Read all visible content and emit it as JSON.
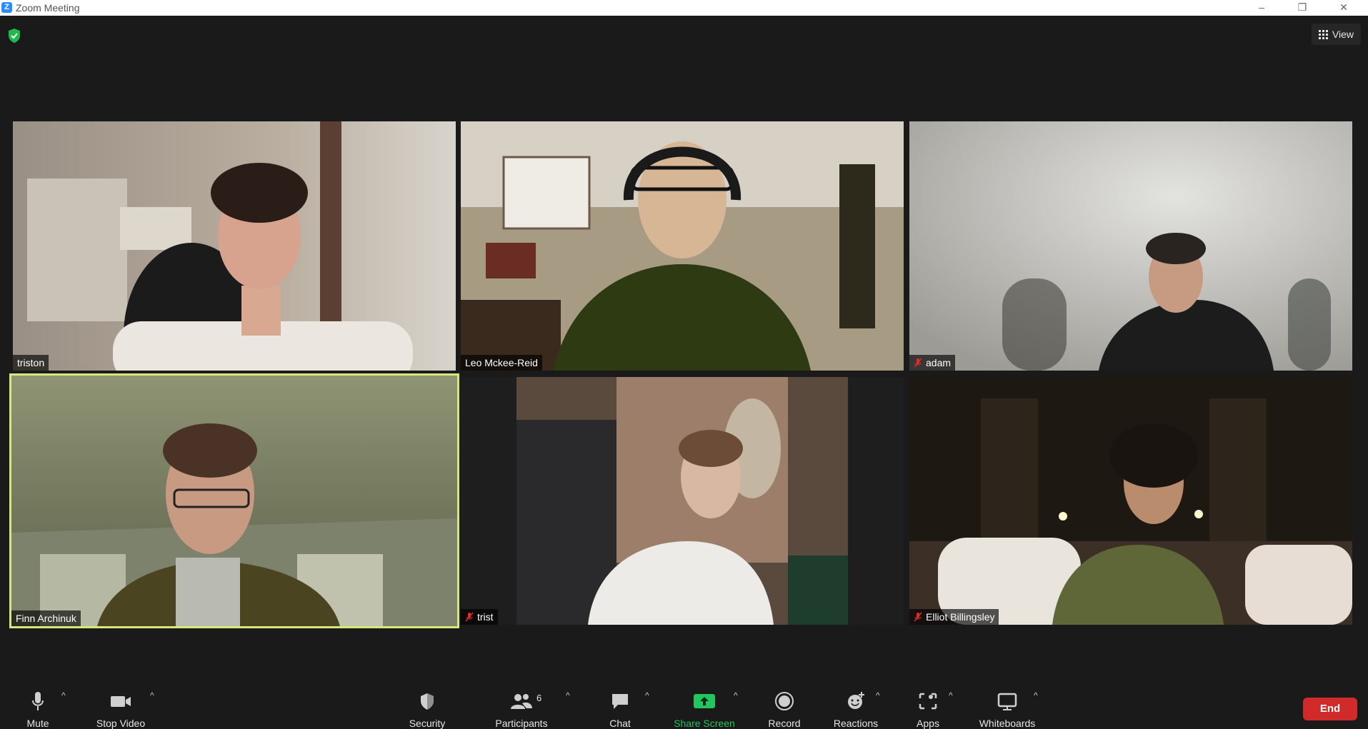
{
  "window": {
    "title": "Zoom Meeting",
    "app_icon": "Z",
    "minimize": "–",
    "restore": "❐",
    "close": "✕"
  },
  "header": {
    "view_label": "View"
  },
  "participants": [
    {
      "name": "triston",
      "muted": false
    },
    {
      "name": "Leo Mckee-Reid",
      "muted": false
    },
    {
      "name": "adam",
      "muted": true
    },
    {
      "name": "Finn Archinuk",
      "muted": false,
      "active_speaker": true
    },
    {
      "name": "trist",
      "muted": true
    },
    {
      "name": "Elliot Billingsley",
      "muted": true
    }
  ],
  "toolbar": {
    "mute": "Mute",
    "stop_video": "Stop Video",
    "security": "Security",
    "participants": "Participants",
    "participants_count": "6",
    "chat": "Chat",
    "share_screen": "Share Screen",
    "record": "Record",
    "reactions": "Reactions",
    "apps": "Apps",
    "whiteboards": "Whiteboards",
    "end": "End",
    "caret": "^"
  },
  "colors": {
    "accent_green": "#22c55e",
    "end_red": "#d02a2a",
    "active_outline": "#d6e87a",
    "mute_red": "#e02b2b"
  }
}
